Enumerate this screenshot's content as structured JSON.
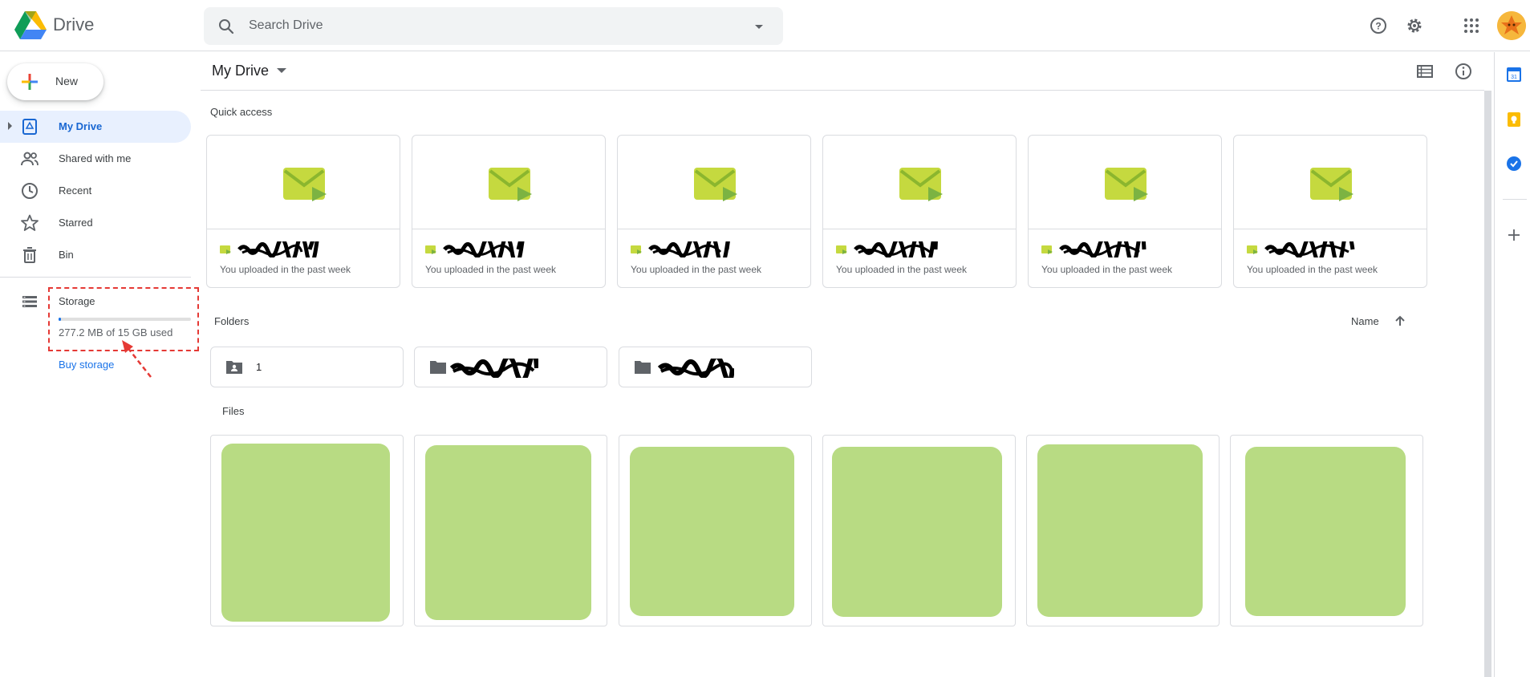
{
  "app": {
    "name": "Drive",
    "logo_icon": "google-drive-logo"
  },
  "search": {
    "placeholder": "Search Drive",
    "icon": "search-icon",
    "options_icon": "dropdown-arrow-icon"
  },
  "header_icons": [
    "help-icon",
    "settings-gear-icon",
    "apps-grid-icon",
    "account-avatar"
  ],
  "new_button": {
    "label": "New",
    "icon": "plus-multicolor-icon"
  },
  "sidebar": {
    "items": [
      {
        "label": "My Drive",
        "icon": "my-drive-icon",
        "active": true
      },
      {
        "label": "Shared with me",
        "icon": "shared-people-icon",
        "active": false
      },
      {
        "label": "Recent",
        "icon": "clock-icon",
        "active": false
      },
      {
        "label": "Starred",
        "icon": "star-icon",
        "active": false
      },
      {
        "label": "Bin",
        "icon": "trash-icon",
        "active": false
      }
    ],
    "storage": {
      "label": "Storage",
      "icon": "storage-icon",
      "used_text": "277.2 MB of 15 GB used",
      "used_fraction": 0.018,
      "buy_label": "Buy storage"
    }
  },
  "annotation": {
    "highlight_color": "#e53935"
  },
  "main": {
    "title": "My Drive",
    "toolbar_icons": [
      "list-view-icon",
      "info-icon"
    ],
    "quick_access": {
      "label": "Quick access",
      "items": [
        {
          "subtitle": "You uploaded in the past week"
        },
        {
          "subtitle": "You uploaded in the past week"
        },
        {
          "subtitle": "You uploaded in the past week"
        },
        {
          "subtitle": "You uploaded in the past week"
        },
        {
          "subtitle": "You uploaded in the past week"
        },
        {
          "subtitle": "You uploaded in the past week"
        }
      ]
    },
    "folders": {
      "label": "Folders",
      "sort_label": "Name",
      "items": [
        {
          "name": "1",
          "icon": "shared-folder-icon"
        },
        {
          "name": "",
          "icon": "folder-icon"
        },
        {
          "name": "",
          "icon": "folder-icon"
        }
      ]
    },
    "files": {
      "label": "Files",
      "count": 6
    }
  },
  "right_panel_icons": [
    "calendar-icon",
    "keep-icon",
    "tasks-icon",
    "add-icon"
  ],
  "colors": {
    "accent": "#1a73e8",
    "active_bg": "#e8f0fe",
    "thumb_green": "#b8db83",
    "envelope_green": "#c5d93f"
  }
}
